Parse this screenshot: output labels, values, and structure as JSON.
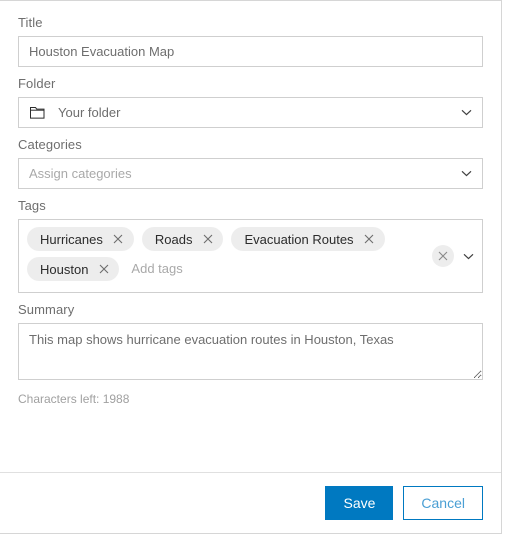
{
  "form": {
    "title_field": {
      "label": "Title",
      "value": "Houston Evacuation Map",
      "placeholder": "Title"
    },
    "folder_field": {
      "label": "Folder",
      "value": "Your folder",
      "icon": "folder-icon",
      "chevron": "chevron-down-icon"
    },
    "categories_field": {
      "label": "Categories",
      "placeholder": "Assign categories",
      "value": "Assign categories",
      "chevron": "chevron-down-icon"
    },
    "tags_field": {
      "label": "Tags",
      "placeholder": "Add tags",
      "chips": [
        {
          "label": "Hurricanes",
          "remove": "close-icon"
        },
        {
          "label": "Roads",
          "remove": "close-icon"
        },
        {
          "label": "Evacuation Routes",
          "remove": "close-icon"
        },
        {
          "label": "Houston",
          "remove": "close-icon"
        }
      ],
      "clear_icon": "close-icon",
      "chevron": "chevron-down-icon"
    },
    "summary_field": {
      "label": "Summary",
      "value": "This map shows hurricane evacuation routes in Houston, Texas",
      "placeholder": "Summary",
      "characters_left": "Characters left: 1988"
    }
  },
  "footer": {
    "save_label": "Save",
    "cancel_label": "Cancel"
  },
  "colors": {
    "accent": "#0079c1",
    "cancel_text": "#4a9fd4",
    "chip_bg": "#ededed",
    "border": "#cfcfcf",
    "label_text": "#6e6e6e",
    "placeholder_text": "#a9a9a9"
  }
}
